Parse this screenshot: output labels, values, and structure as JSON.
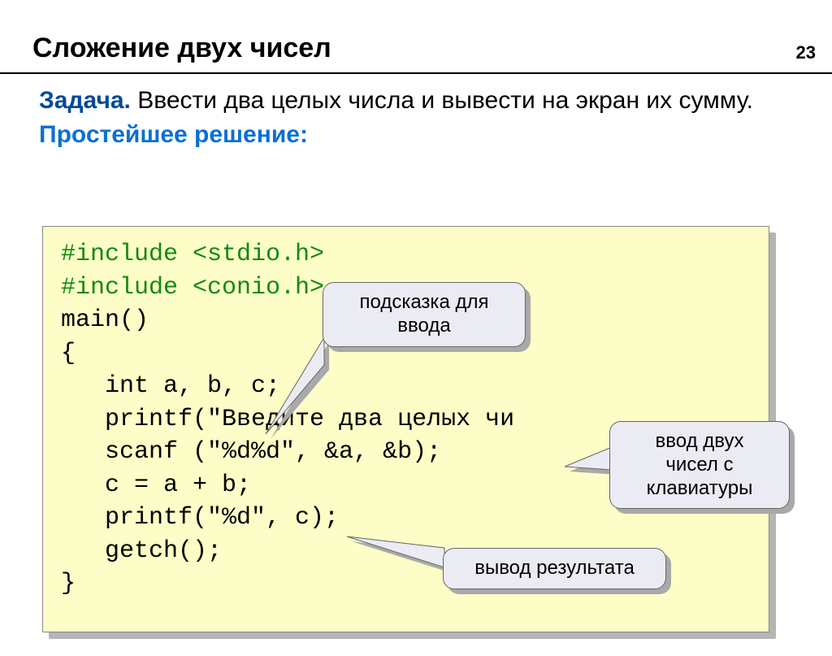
{
  "page_number": "23",
  "title": "Сложение двух чисел",
  "task_label": "Задача.",
  "task_text": " Ввести два целых числа и вывести на экран их сумму.",
  "solution_heading": "Простейшее решение:",
  "code": {
    "l1": "#include <stdio.h>",
    "l2": "#include <conio.h>",
    "l3": "main()",
    "l4": "{",
    "l5": "   int a, b, c;",
    "l6": "   printf(\"Введите два целых чи",
    "l7": "   scanf (\"%d%d\", &a, &b);",
    "l8": "   c = a + b;",
    "l9": "   printf(\"%d\", c);",
    "l10": "   getch();",
    "l11": "}"
  },
  "callouts": {
    "c1_line1": "подсказка для",
    "c1_line2": "ввода",
    "c2_line1": "ввод двух",
    "c2_line2": "чисел с",
    "c2_line3": "клавиатуры",
    "c3": "вывод результата"
  }
}
